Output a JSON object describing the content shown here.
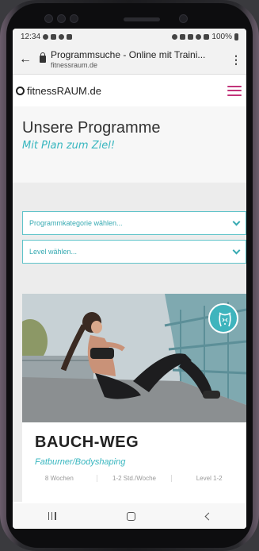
{
  "status_bar": {
    "time": "12:34",
    "battery": "100%"
  },
  "browser": {
    "page_title": "Programmsuche - Online mit Traini...",
    "domain": "fitnessraum.de"
  },
  "site": {
    "logo_text": "fitnessRAUM.de",
    "accent_color": "#37b6bf",
    "menu_color": "#c2347a"
  },
  "hero": {
    "title": "Unsere Programme",
    "subtitle": "Mit Plan zum Ziel!"
  },
  "filters": {
    "category_placeholder": "Programmkategorie wählen...",
    "level_placeholder": "Level wählen..."
  },
  "program_card": {
    "title": "BAUCH-WEG",
    "subtitle": "Fatburner/Bodyshaping",
    "meta": [
      "8 Wochen",
      "1-2 Std./Woche",
      "Level 1-2"
    ],
    "badge_icon": "torso-icon"
  },
  "android_nav": {
    "icons": [
      "recent-apps-icon",
      "home-icon",
      "back-icon"
    ]
  }
}
